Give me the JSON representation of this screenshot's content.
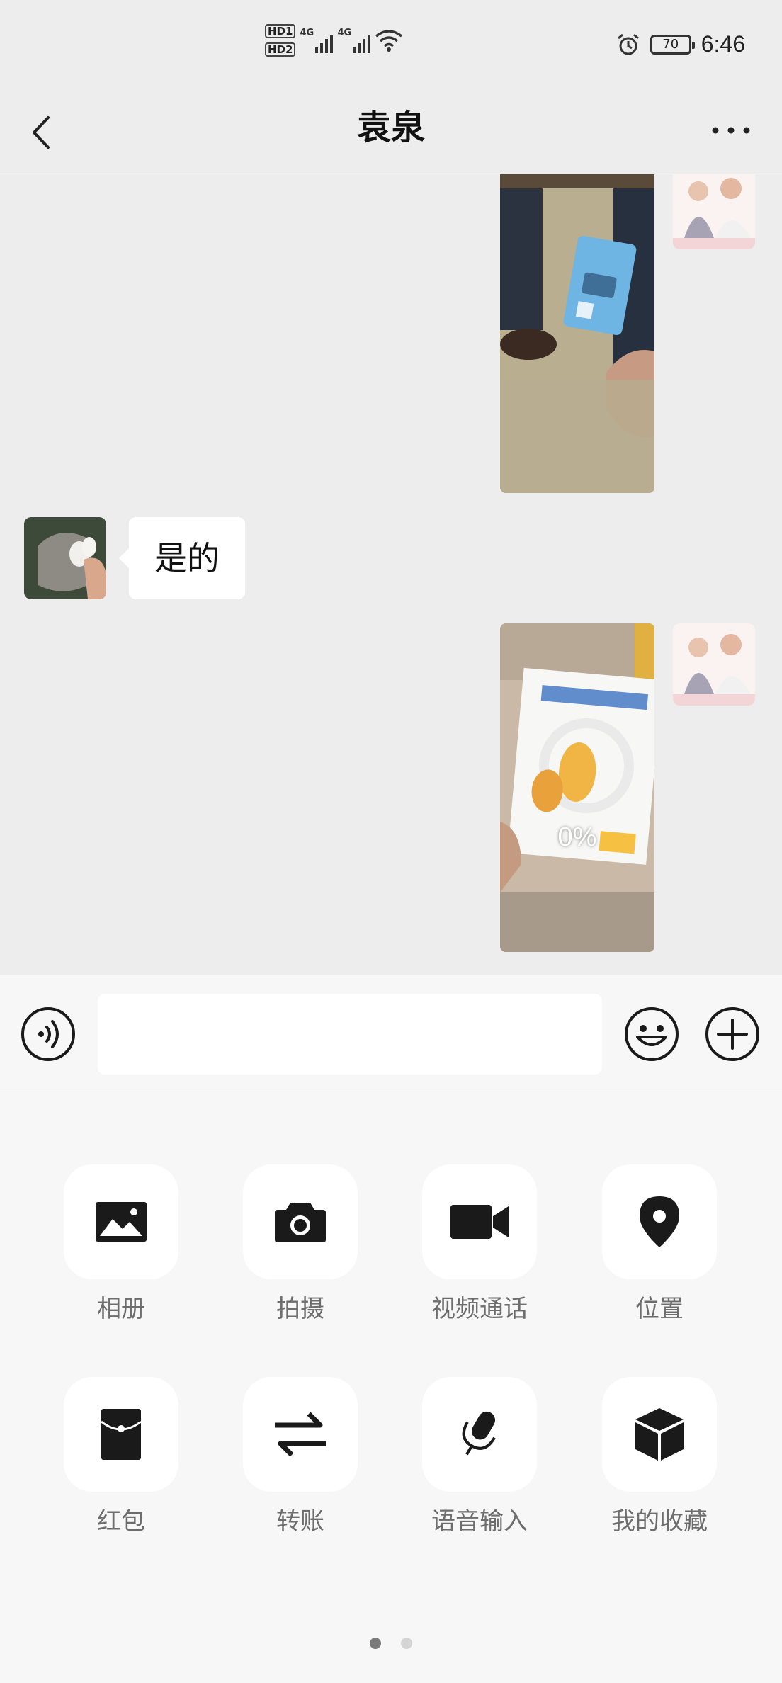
{
  "status_bar": {
    "hd1": "HD1",
    "hd2": "HD2",
    "net1": "4G",
    "net2": "4G",
    "battery": "70",
    "time": "6:46"
  },
  "nav": {
    "title": "袁泉",
    "back_icon": "chevron-left-icon",
    "more_icon": "more-dots-icon"
  },
  "messages": [
    {
      "side": "right",
      "type": "image",
      "desc_icon": "photo-sim-card"
    },
    {
      "side": "left",
      "type": "text",
      "text": "是的"
    },
    {
      "side": "right",
      "type": "image",
      "desc_icon": "photo-book",
      "progress": "0%"
    }
  ],
  "input_bar": {
    "voice_icon": "voice-icon",
    "emoji_icon": "emoji-icon",
    "plus_icon": "plus-icon",
    "placeholder": ""
  },
  "panel": {
    "items": [
      {
        "label": "相册",
        "icon": "image-icon"
      },
      {
        "label": "拍摄",
        "icon": "camera-icon"
      },
      {
        "label": "视频通话",
        "icon": "video-call-icon"
      },
      {
        "label": "位置",
        "icon": "location-icon"
      },
      {
        "label": "红包",
        "icon": "red-packet-icon"
      },
      {
        "label": "转账",
        "icon": "transfer-icon"
      },
      {
        "label": "语音输入",
        "icon": "microphone-icon"
      },
      {
        "label": "我的收藏",
        "icon": "favorites-icon"
      }
    ],
    "page_count": 2,
    "active_page": 1
  },
  "colors": {
    "background": "#ededed",
    "panel_bg": "#f7f7f7",
    "icon": "#1a1a1a",
    "label": "#6d6d6d"
  }
}
